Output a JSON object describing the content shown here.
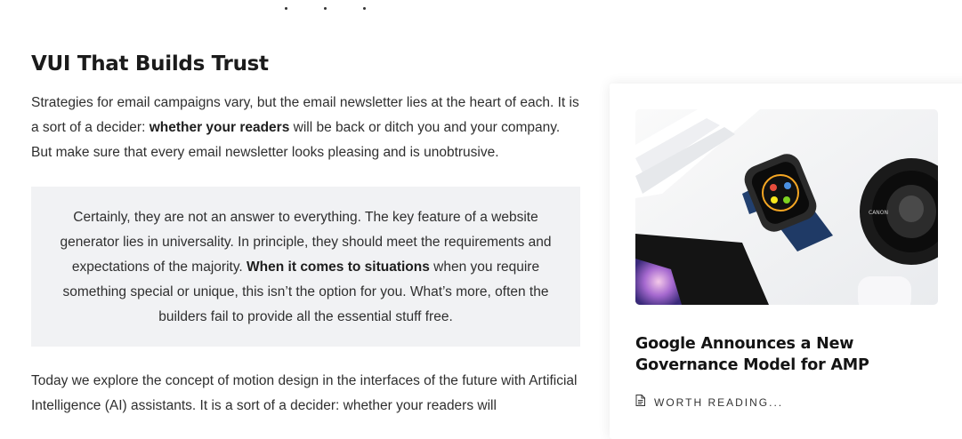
{
  "article": {
    "heading": "VUI That Builds Trust",
    "intro": {
      "part1": "Strategies for email campaigns vary, but the email newsletter lies at the heart of each. It is a sort of a decider: ",
      "bold": "whether your readers",
      "part2": " will be back or ditch you and your company. But make sure that every email newsletter looks pleasing and is unobtrusive."
    },
    "quote": {
      "part1": "Certainly, they are not an answer to everything. The key feature of a website generator lies in universality. In principle, they should meet the requirements and expectations of the majority. ",
      "bold": "When it comes to situations",
      "part2": " when you require something special or unique, this isn’t the option for you. What’s more, often the builders fail to provide all the essential stuff free."
    },
    "outro": "Today we explore the concept of motion design in the interfaces of the future with Artificial Intelligence (AI) assistants. It is a sort of a decider: whether your readers will"
  },
  "card": {
    "title": "Google Announces a New Governance Model for AMP",
    "meta_label": "WORTH READING...",
    "meta_icon": "document-icon"
  }
}
